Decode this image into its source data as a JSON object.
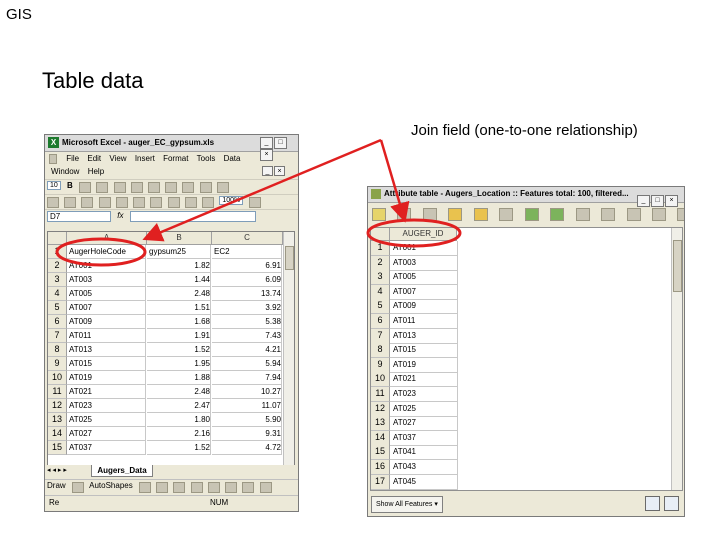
{
  "slide": {
    "corner_label": "GIS",
    "title": "Table data",
    "callout": "Join field (one-to-one relationship)",
    "highlight_color": "#e02020"
  },
  "excel": {
    "title": "Microsoft Excel - auger_EC_gypsum.xls",
    "menu_row1": [
      "File",
      "Edit",
      "View",
      "Insert",
      "Format",
      "Tools",
      "Data"
    ],
    "menu_row2": [
      "Window",
      "Help"
    ],
    "font_size_box": "10",
    "bold_label": "B",
    "zoom": "100%",
    "name_box": "D7",
    "fx": "fx",
    "columns": [
      "A",
      "B",
      "C"
    ],
    "row_numbers": [
      "1",
      "2",
      "3",
      "4",
      "5",
      "6",
      "7",
      "8",
      "9",
      "10",
      "11",
      "12",
      "13",
      "14",
      "15"
    ],
    "headers": [
      "AugerHoleCode",
      "gypsum25",
      "EC2"
    ],
    "rows": [
      [
        "AT001",
        "1.82",
        "6.91"
      ],
      [
        "AT003",
        "1.44",
        "6.09"
      ],
      [
        "AT005",
        "2.48",
        "13.74"
      ],
      [
        "AT007",
        "1.51",
        "3.92"
      ],
      [
        "AT009",
        "1.68",
        "5.38"
      ],
      [
        "AT011",
        "1.91",
        "7.43"
      ],
      [
        "AT013",
        "1.52",
        "4.21"
      ],
      [
        "AT015",
        "1.95",
        "5.94"
      ],
      [
        "AT019",
        "1.88",
        "7.94"
      ],
      [
        "AT021",
        "2.48",
        "10.27"
      ],
      [
        "AT023",
        "2.47",
        "11.07"
      ],
      [
        "AT025",
        "1.80",
        "5.90"
      ],
      [
        "AT027",
        "2.16",
        "9.31"
      ],
      [
        "AT037",
        "1.52",
        "4.72"
      ]
    ],
    "sheet_tab": "Augers_Data",
    "draw_label": "Draw",
    "autoshapes_label": "AutoShapes",
    "status_left": "Re",
    "status_num": "NUM"
  },
  "attribute_table": {
    "title": "Attribute table - Augers_Location :: Features total: 100, filtered...",
    "column_header": "AUGER_ID",
    "row_numbers": [
      "1",
      "2",
      "3",
      "4",
      "5",
      "6",
      "7",
      "8",
      "9",
      "10",
      "11",
      "12",
      "13",
      "14",
      "15",
      "16",
      "17"
    ],
    "values": [
      "AT001",
      "AT003",
      "AT005",
      "AT007",
      "AT009",
      "AT011",
      "AT013",
      "AT015",
      "AT019",
      "AT021",
      "AT023",
      "AT025",
      "AT027",
      "AT037",
      "AT041",
      "AT043",
      "AT045",
      "AT047"
    ],
    "show_button": "Show All Features"
  }
}
